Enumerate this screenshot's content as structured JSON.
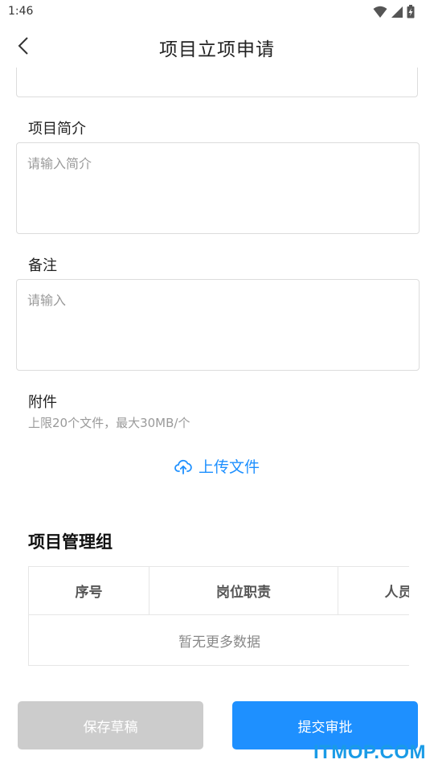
{
  "status_bar": {
    "time": "1:46"
  },
  "header": {
    "title": "项目立项申请"
  },
  "form": {
    "intro": {
      "label": "项目简介",
      "placeholder": "请输入简介"
    },
    "remark": {
      "label": "备注",
      "placeholder": "请输入"
    },
    "attachment": {
      "label": "附件",
      "hint": "上限20个文件，最大30MB/个",
      "upload_label": "上传文件"
    }
  },
  "team": {
    "title": "项目管理组",
    "columns": [
      "序号",
      "岗位职责",
      "人员"
    ],
    "empty_text": "暂无更多数据"
  },
  "actions": {
    "draft_label": "保存草稿",
    "submit_label": "提交审批"
  },
  "watermark": "ITMOP.COM",
  "colors": {
    "accent": "#1e90ff",
    "disabled": "#cccccc",
    "border": "#dcdcdc"
  }
}
